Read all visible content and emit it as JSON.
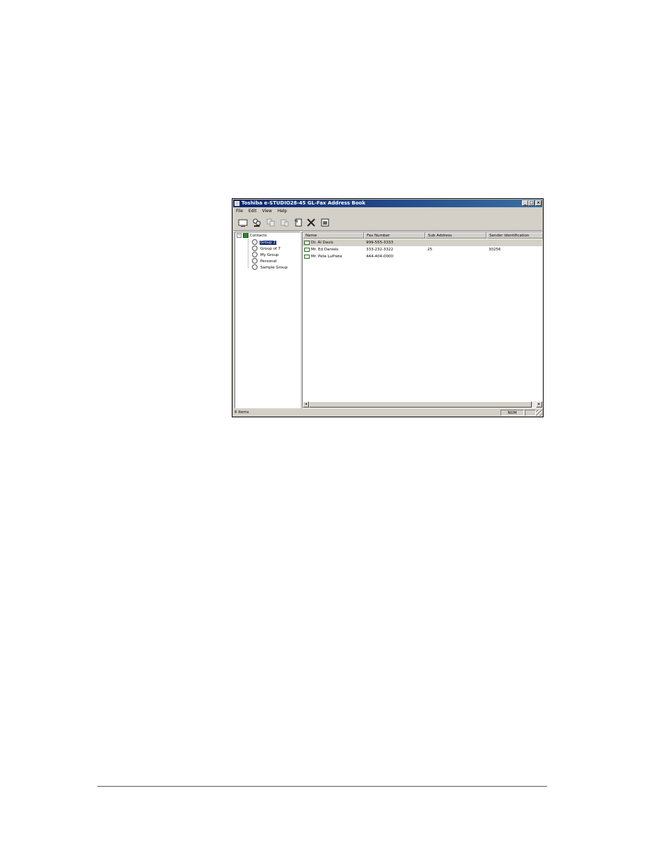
{
  "window": {
    "title": "Toshiba e-STUDIO28-45 GL-Fax Address Book",
    "controls": {
      "minimize": "_",
      "maximize": "□",
      "close": "×"
    }
  },
  "menu": [
    "File",
    "Edit",
    "View",
    "Help"
  ],
  "toolbar": {
    "icons": [
      "new-contact-icon",
      "new-group-icon",
      "copy-icon",
      "paste-icon",
      "properties-icon",
      "delete-icon",
      "import-icon"
    ]
  },
  "tree": {
    "root": "Contacts",
    "expander": "−",
    "items": [
      {
        "label": "Group 2",
        "selected": true
      },
      {
        "label": "Group of 7",
        "selected": false
      },
      {
        "label": "My Group",
        "selected": false
      },
      {
        "label": "Personal",
        "selected": false
      },
      {
        "label": "Sample Group",
        "selected": false
      }
    ]
  },
  "list": {
    "columns": [
      "Name",
      "Fax Number",
      "Sub Address",
      "Sender Identification"
    ],
    "rows": [
      {
        "name": "Dr. Al Davis",
        "fax": "999-555-3333",
        "sub": "",
        "sender": "",
        "selected": true
      },
      {
        "name": "Mr. Ed Daniels",
        "fax": "333-232-3322",
        "sub": "25",
        "sender": "30256",
        "selected": false
      },
      {
        "name": "Mr. Pete LuPrete",
        "fax": "444-404-0000",
        "sub": "",
        "sender": "",
        "selected": false
      }
    ]
  },
  "statusbar": {
    "items": "6 Items",
    "num": "NUM"
  },
  "colors": {
    "titlebar": "#0a246a",
    "selection": "#0a246a",
    "chrome": "#d4d0c8"
  }
}
